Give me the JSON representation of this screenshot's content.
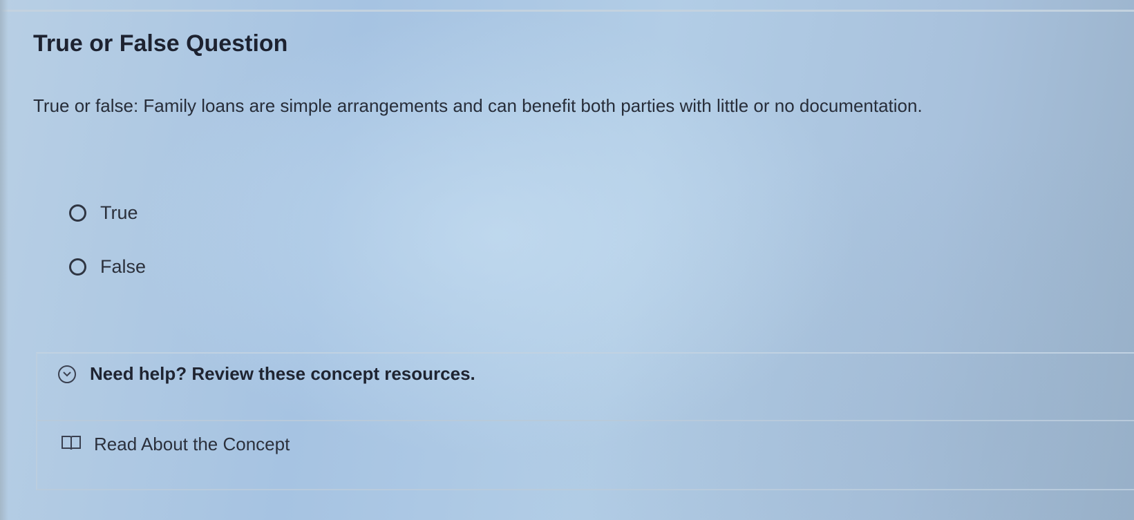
{
  "question": {
    "title": "True or False Question",
    "text": "True or false: Family loans are simple arrangements and can benefit both parties with little or no documentation."
  },
  "options": [
    {
      "label": "True",
      "selected": false,
      "icon": "radio-unselected-icon"
    },
    {
      "label": "False",
      "selected": false,
      "icon": "radio-unselected-icon"
    }
  ],
  "help": {
    "toggle_label": "Need help? Review these concept resources.",
    "toggle_icon": "chevron-down-circle-icon",
    "resources": [
      {
        "label": "Read About the Concept",
        "icon": "book-icon"
      }
    ]
  },
  "colors": {
    "background": "#a9c6e3",
    "text": "#2a2f3a",
    "divider": "#b8cadb"
  }
}
